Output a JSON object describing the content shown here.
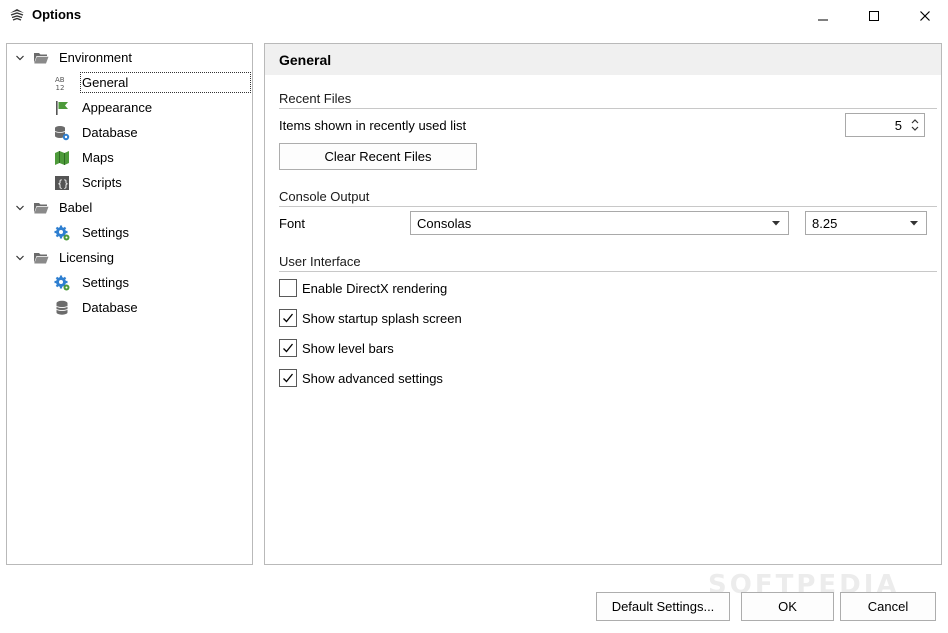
{
  "window": {
    "title": "Options",
    "controls": {
      "minimize": "minimize",
      "maximize": "maximize",
      "close": "close"
    }
  },
  "tree": {
    "groups": [
      {
        "label": "Environment",
        "expanded": true,
        "children": [
          {
            "label": "General",
            "icon": "ab12-icon",
            "selected": true
          },
          {
            "label": "Appearance",
            "icon": "flag-icon"
          },
          {
            "label": "Database",
            "icon": "database-gear-icon"
          },
          {
            "label": "Maps",
            "icon": "map-icon"
          },
          {
            "label": "Scripts",
            "icon": "script-icon"
          }
        ]
      },
      {
        "label": "Babel",
        "expanded": true,
        "children": [
          {
            "label": "Settings",
            "icon": "gear-icon"
          }
        ]
      },
      {
        "label": "Licensing",
        "expanded": true,
        "children": [
          {
            "label": "Settings",
            "icon": "gear-icon"
          },
          {
            "label": "Database",
            "icon": "database-icon"
          }
        ]
      }
    ]
  },
  "content": {
    "title": "General",
    "recent_files": {
      "section": "Recent Files",
      "items_label": "Items shown in recently used list",
      "items_value": "5",
      "clear_button": "Clear Recent Files"
    },
    "console_output": {
      "section": "Console Output",
      "font_label": "Font",
      "font_value": "Consolas",
      "size_value": "8.25"
    },
    "user_interface": {
      "section": "User Interface",
      "checkboxes": [
        {
          "label": "Enable DirectX rendering",
          "checked": false
        },
        {
          "label": "Show startup splash screen",
          "checked": true
        },
        {
          "label": "Show level bars",
          "checked": true
        },
        {
          "label": "Show advanced settings",
          "checked": true
        }
      ]
    }
  },
  "footer": {
    "default_button": "Default Settings...",
    "ok_button": "OK",
    "cancel_button": "Cancel"
  },
  "watermark": "SOFTPEDIA",
  "colors": {
    "panel_border": "#b9b9b9",
    "header_bg": "#f0f0f0",
    "gear_blue": "#2f7fd0",
    "folder_gray": "#6b6b6b",
    "icon_green": "#4d9a3a"
  }
}
